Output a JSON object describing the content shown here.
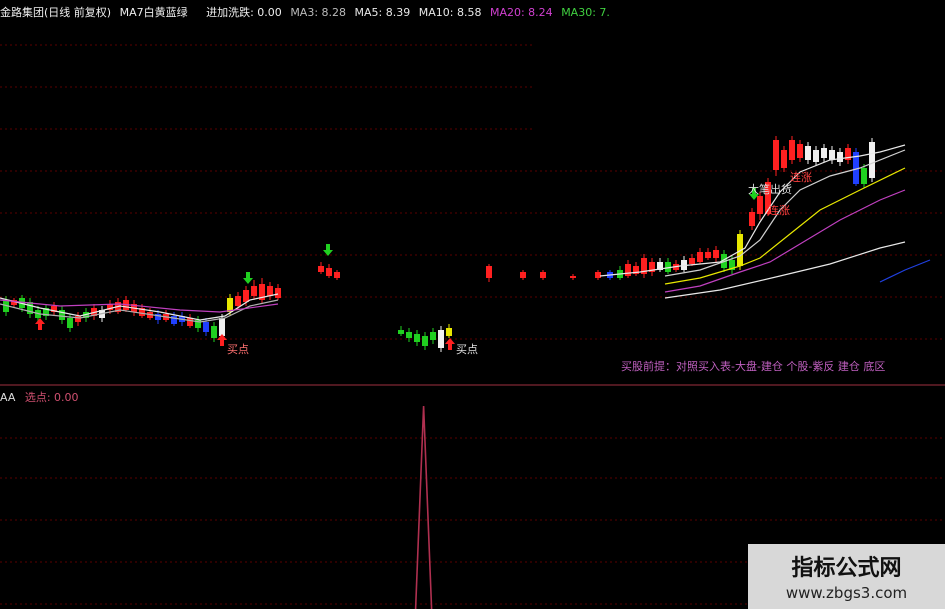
{
  "header": {
    "stock": "金路集团(日线 前复权)",
    "ma_note": "MA7白黄蓝绿",
    "indicator": "进加洗跌: 0.00",
    "ma3": "MA3: 8.28",
    "ma5": "MA5: 8.39",
    "ma10": "MA10: 8.58",
    "ma20": "MA20: 8.24",
    "ma30": "MA30: 7."
  },
  "sub_header": {
    "name": "AA",
    "value": "选点: 0.00"
  },
  "labels": {
    "buy1": "买点",
    "buy2": "买点",
    "big": "大笔出货",
    "up1": "连涨",
    "up2": "连涨"
  },
  "tip": "买股前提：对照买入表-大盘-建仓  个股-紫反 建仓 底区",
  "watermark": {
    "title": "指标公式网",
    "url": "www.zbgs3.com"
  },
  "colors": {
    "up": "#ff2020",
    "down": "#20d020",
    "bg": "#000000",
    "grid": "#5a0000",
    "ma_white": "#e8e8e8",
    "ma_yellow": "#e8e800",
    "ma_purple": "#c040c0",
    "ma_green": "#20c020",
    "signal": "#b03050"
  },
  "chart_data": {
    "type": "line",
    "sub_chart": {
      "series": [
        {
          "name": "选点",
          "peak_index": 49,
          "peak_value": 1
        }
      ],
      "ylim": [
        0,
        1
      ]
    }
  }
}
